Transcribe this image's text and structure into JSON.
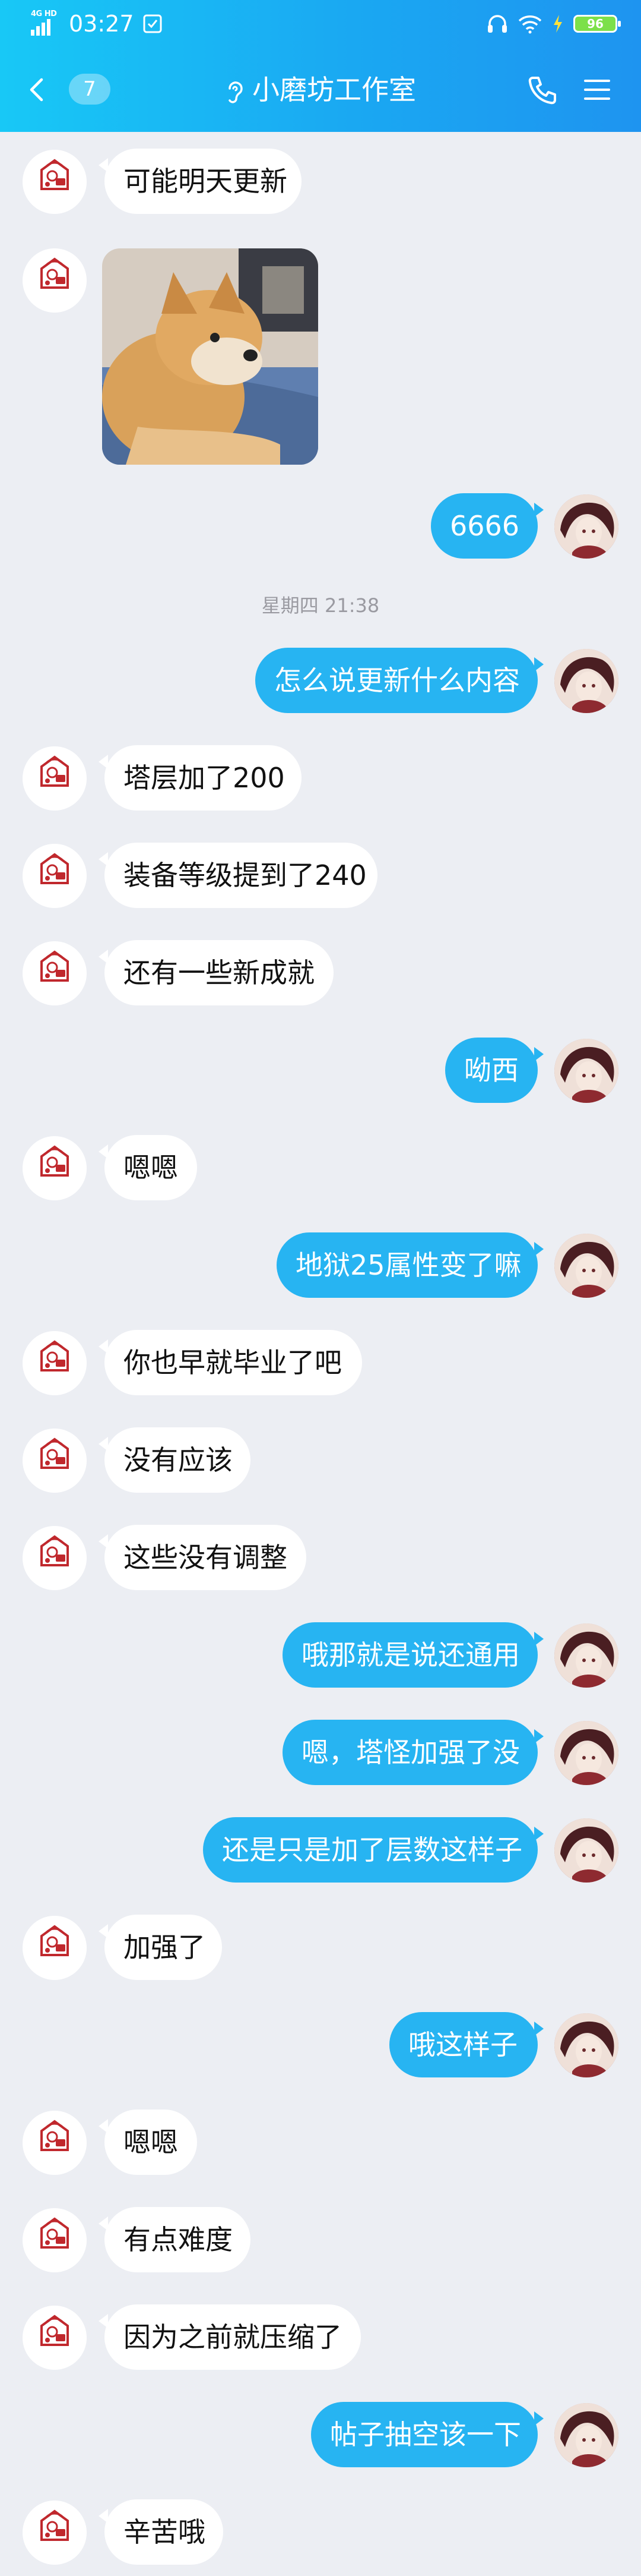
{
  "status_bar": {
    "network": "4G HD",
    "time": "03:27",
    "battery": "96"
  },
  "header": {
    "unread_count": "7",
    "title": "小磨坊工作室"
  },
  "messages": [
    {
      "direction": "in",
      "text": "可能明天更新"
    },
    {
      "direction": "in",
      "type": "image",
      "image": "dog-photo"
    },
    {
      "direction": "out",
      "text": "6666"
    },
    {
      "type": "timestamp",
      "text": "星期四 21:38"
    },
    {
      "direction": "out",
      "text": "怎么说更新什么内容"
    },
    {
      "direction": "in",
      "text": "塔层加了200"
    },
    {
      "direction": "in",
      "text": "装备等级提到了240"
    },
    {
      "direction": "in",
      "text": "还有一些新成就"
    },
    {
      "direction": "out",
      "text": "呦西"
    },
    {
      "direction": "in",
      "text": "嗯嗯"
    },
    {
      "direction": "out",
      "text": "地狱25属性变了嘛"
    },
    {
      "direction": "in",
      "text": "你也早就毕业了吧"
    },
    {
      "direction": "in",
      "text": "没有应该"
    },
    {
      "direction": "in",
      "text": "这些没有调整"
    },
    {
      "direction": "out",
      "text": "哦那就是说还通用"
    },
    {
      "direction": "out",
      "text": "嗯，塔怪加强了没"
    },
    {
      "direction": "out",
      "text": "还是只是加了层数这样子"
    },
    {
      "direction": "in",
      "text": "加强了"
    },
    {
      "direction": "out",
      "text": "哦这样子"
    },
    {
      "direction": "in",
      "text": "嗯嗯"
    },
    {
      "direction": "in",
      "text": "有点难度"
    },
    {
      "direction": "in",
      "text": "因为之前就压缩了"
    },
    {
      "direction": "out",
      "text": "帖子抽空该一下"
    },
    {
      "direction": "in",
      "text": "辛苦哦"
    }
  ],
  "avatar": {
    "shop_label": "小磨坊工作室"
  },
  "colors": {
    "header_start": "#18c8f6",
    "header_end": "#1e94f0",
    "bubble_out": "#27b4f2",
    "bubble_in": "#ffffff",
    "background": "#eceef3"
  }
}
